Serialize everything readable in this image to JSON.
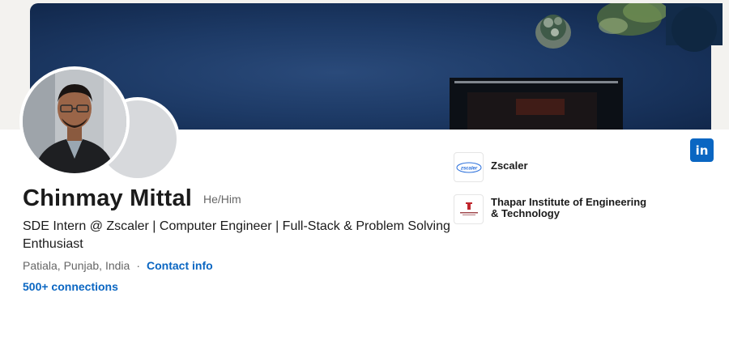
{
  "profile": {
    "name": "Chinmay Mittal",
    "pronouns": "He/Him",
    "headline": "SDE Intern @ Zscaler | Computer Engineer | Full-Stack & Problem Solving Enthusiast",
    "location": "Patiala, Punjab, India",
    "separator": "·",
    "contact_label": "Contact info",
    "connections_label": "500+ connections"
  },
  "organizations": [
    {
      "name": "Zscaler",
      "logo_text": "zscaler",
      "icon": "zscaler-logo"
    },
    {
      "name": "Thapar Institute of Engineering & Technology",
      "icon": "thapar-logo"
    }
  ],
  "social": {
    "linkedin_label": "in",
    "icon": "linkedin-icon"
  },
  "colors": {
    "link": "#0a66c2",
    "cover": "#1d3a66",
    "linkedin": "#0a66c2"
  }
}
